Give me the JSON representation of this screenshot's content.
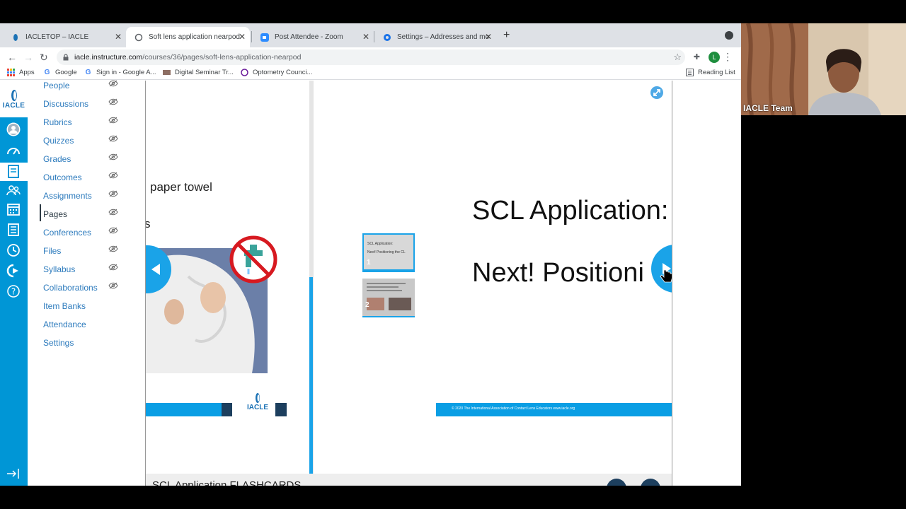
{
  "tabs": [
    {
      "title": "IACLETOP – IACLE",
      "icon": "iacle-favicon",
      "active": false
    },
    {
      "title": "Soft lens application nearpod",
      "icon": "canvas-favicon",
      "active": true
    },
    {
      "title": "Post Attendee - Zoom",
      "icon": "zoom-favicon",
      "active": false
    },
    {
      "title": "Settings – Addresses and more",
      "icon": "gear-icon",
      "active": false
    }
  ],
  "address": {
    "url_host": "iacle.instructure.com",
    "url_path": "/courses/36/pages/soft-lens-application-nearpod",
    "profile_initial": "L"
  },
  "bookmarks": {
    "items": [
      {
        "label": "Apps",
        "icon": "apps-grid-icon"
      },
      {
        "label": "Google",
        "icon": "google-icon"
      },
      {
        "label": "Sign in - Google A...",
        "icon": "google-icon"
      },
      {
        "label": "Digital Seminar Tr...",
        "icon": "seminar-icon"
      },
      {
        "label": "Optometry Counci...",
        "icon": "optometry-icon"
      }
    ],
    "reading_list": "Reading List"
  },
  "global_nav": {
    "logo_text": "IACLE"
  },
  "course_nav": {
    "items": [
      {
        "label": "People"
      },
      {
        "label": "Discussions"
      },
      {
        "label": "Rubrics"
      },
      {
        "label": "Quizzes"
      },
      {
        "label": "Grades"
      },
      {
        "label": "Outcomes"
      },
      {
        "label": "Assignments"
      },
      {
        "label": "Pages"
      },
      {
        "label": "Conferences"
      },
      {
        "label": "Files"
      },
      {
        "label": "Syllabus"
      },
      {
        "label": "Collaborations"
      },
      {
        "label": "Item Banks"
      },
      {
        "label": "Attendance"
      },
      {
        "label": "Settings"
      }
    ],
    "active": "Pages"
  },
  "left_slide": {
    "text": "paper towel",
    "stray_char": "s",
    "logo_text": "IACLE"
  },
  "right_slide": {
    "title_line1": "SCL Application:",
    "title_line2": "Next! Positioni",
    "thumbs": [
      {
        "number": "1",
        "line1": "SCL Application:",
        "line2": "Next! Positioning the CL"
      },
      {
        "number": "2"
      }
    ],
    "footer": "© 2020 The International Association of Contact Lens Educators   www.iacle.org"
  },
  "bottom_bar": {
    "title": "SCL Application FLASHCARDS"
  },
  "zoom": {
    "participant_name": "IACLE Team"
  },
  "colors": {
    "canvas_blue": "#0096d6",
    "nearpod_blue": "#1aa3e8",
    "link_blue": "#2d7bbd"
  }
}
